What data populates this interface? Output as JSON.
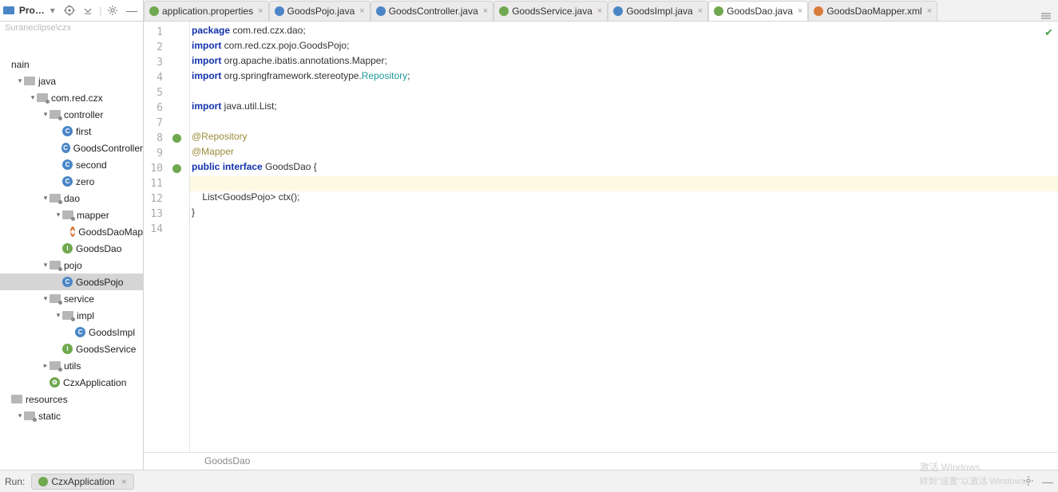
{
  "sidebar": {
    "title": "Proj...",
    "path": "Suraneclipse\\czx",
    "tree": [
      {
        "indent": 0,
        "chev": "",
        "icon": "",
        "label": "",
        "blank": true
      },
      {
        "indent": 0,
        "chev": "",
        "icon": "",
        "label": "nain",
        "raw": true
      },
      {
        "indent": 1,
        "chev": "v",
        "icon": "folder",
        "label": "java"
      },
      {
        "indent": 2,
        "chev": "v",
        "icon": "folder-pkg",
        "label": "com.red.czx"
      },
      {
        "indent": 3,
        "chev": "v",
        "icon": "folder-pkg",
        "label": "controller"
      },
      {
        "indent": 4,
        "chev": "",
        "icon": "c",
        "label": "first"
      },
      {
        "indent": 4,
        "chev": "",
        "icon": "c",
        "label": "GoodsController"
      },
      {
        "indent": 4,
        "chev": "",
        "icon": "c",
        "label": "second"
      },
      {
        "indent": 4,
        "chev": "",
        "icon": "c",
        "label": "zero"
      },
      {
        "indent": 3,
        "chev": "v",
        "icon": "folder-pkg",
        "label": "dao"
      },
      {
        "indent": 4,
        "chev": "v",
        "icon": "folder-pkg",
        "label": "mapper"
      },
      {
        "indent": 5,
        "chev": "",
        "icon": "x",
        "label": "GoodsDaoMap"
      },
      {
        "indent": 4,
        "chev": "",
        "icon": "i",
        "label": "GoodsDao"
      },
      {
        "indent": 3,
        "chev": "v",
        "icon": "folder-pkg",
        "label": "pojo"
      },
      {
        "indent": 4,
        "chev": "",
        "icon": "c",
        "label": "GoodsPojo",
        "selected": true
      },
      {
        "indent": 3,
        "chev": "v",
        "icon": "folder-pkg",
        "label": "service"
      },
      {
        "indent": 4,
        "chev": "v",
        "icon": "folder-pkg",
        "label": "impl"
      },
      {
        "indent": 5,
        "chev": "",
        "icon": "c",
        "label": "GoodsImpl"
      },
      {
        "indent": 4,
        "chev": "",
        "icon": "i",
        "label": "GoodsService"
      },
      {
        "indent": 3,
        "chev": ">",
        "icon": "folder-pkg",
        "label": "utils"
      },
      {
        "indent": 3,
        "chev": "",
        "icon": "s",
        "label": "CzxApplication"
      },
      {
        "indent": 1,
        "chev": "",
        "icon": "folder",
        "label": "resources",
        "raw": true,
        "indent0": true
      },
      {
        "indent": 1,
        "chev": "v",
        "icon": "folder-pkg",
        "label": "static"
      }
    ]
  },
  "tabs": [
    {
      "label": "application.properties",
      "icon": "#6fa84f"
    },
    {
      "label": "GoodsPojo.java",
      "icon": "#4a86c7"
    },
    {
      "label": "GoodsController.java",
      "icon": "#4a86c7"
    },
    {
      "label": "GoodsService.java",
      "icon": "#6fa84f"
    },
    {
      "label": "GoodsImpl.java",
      "icon": "#4a86c7"
    },
    {
      "label": "GoodsDao.java",
      "icon": "#6fa84f",
      "active": true
    },
    {
      "label": "GoodsDaoMapper.xml",
      "icon": "#d87c3a"
    }
  ],
  "code": {
    "lines": [
      {
        "n": 1,
        "html": "<span class='kw'>package</span> com.red.czx.dao;"
      },
      {
        "n": 2,
        "html": "<span class='kw'>import</span> com.red.czx.pojo.GoodsPojo;"
      },
      {
        "n": 3,
        "html": "<span class='kw'>import</span> org.apache.ibatis.annotations.Mapper;"
      },
      {
        "n": 4,
        "html": "<span class='kw'>import</span> org.springframework.stereotype.<span class='cls'>Repository</span>;"
      },
      {
        "n": 5,
        "html": ""
      },
      {
        "n": 6,
        "html": "<span class='kw'>import</span> java.util.List;"
      },
      {
        "n": 7,
        "html": ""
      },
      {
        "n": 8,
        "html": "<span class='ann'>@Repository</span>",
        "gicon": true
      },
      {
        "n": 9,
        "html": "<span class='ann'>@Mapper</span>"
      },
      {
        "n": 10,
        "html": "<span class='kw'>public</span> <span class='kw'>interface</span> GoodsDao {",
        "gicon": true
      },
      {
        "n": 11,
        "html": "",
        "hl": true
      },
      {
        "n": 12,
        "html": "    List&lt;GoodsPojo&gt; ctx();"
      },
      {
        "n": 13,
        "html": "}"
      },
      {
        "n": 14,
        "html": ""
      }
    ]
  },
  "breadcrumb": "GoodsDao",
  "run": {
    "label": "Run:",
    "tab": "CzxApplication"
  },
  "watermark": {
    "main": "激活 Windows",
    "sub": "转到\"设置\"以激活 Windows。"
  }
}
